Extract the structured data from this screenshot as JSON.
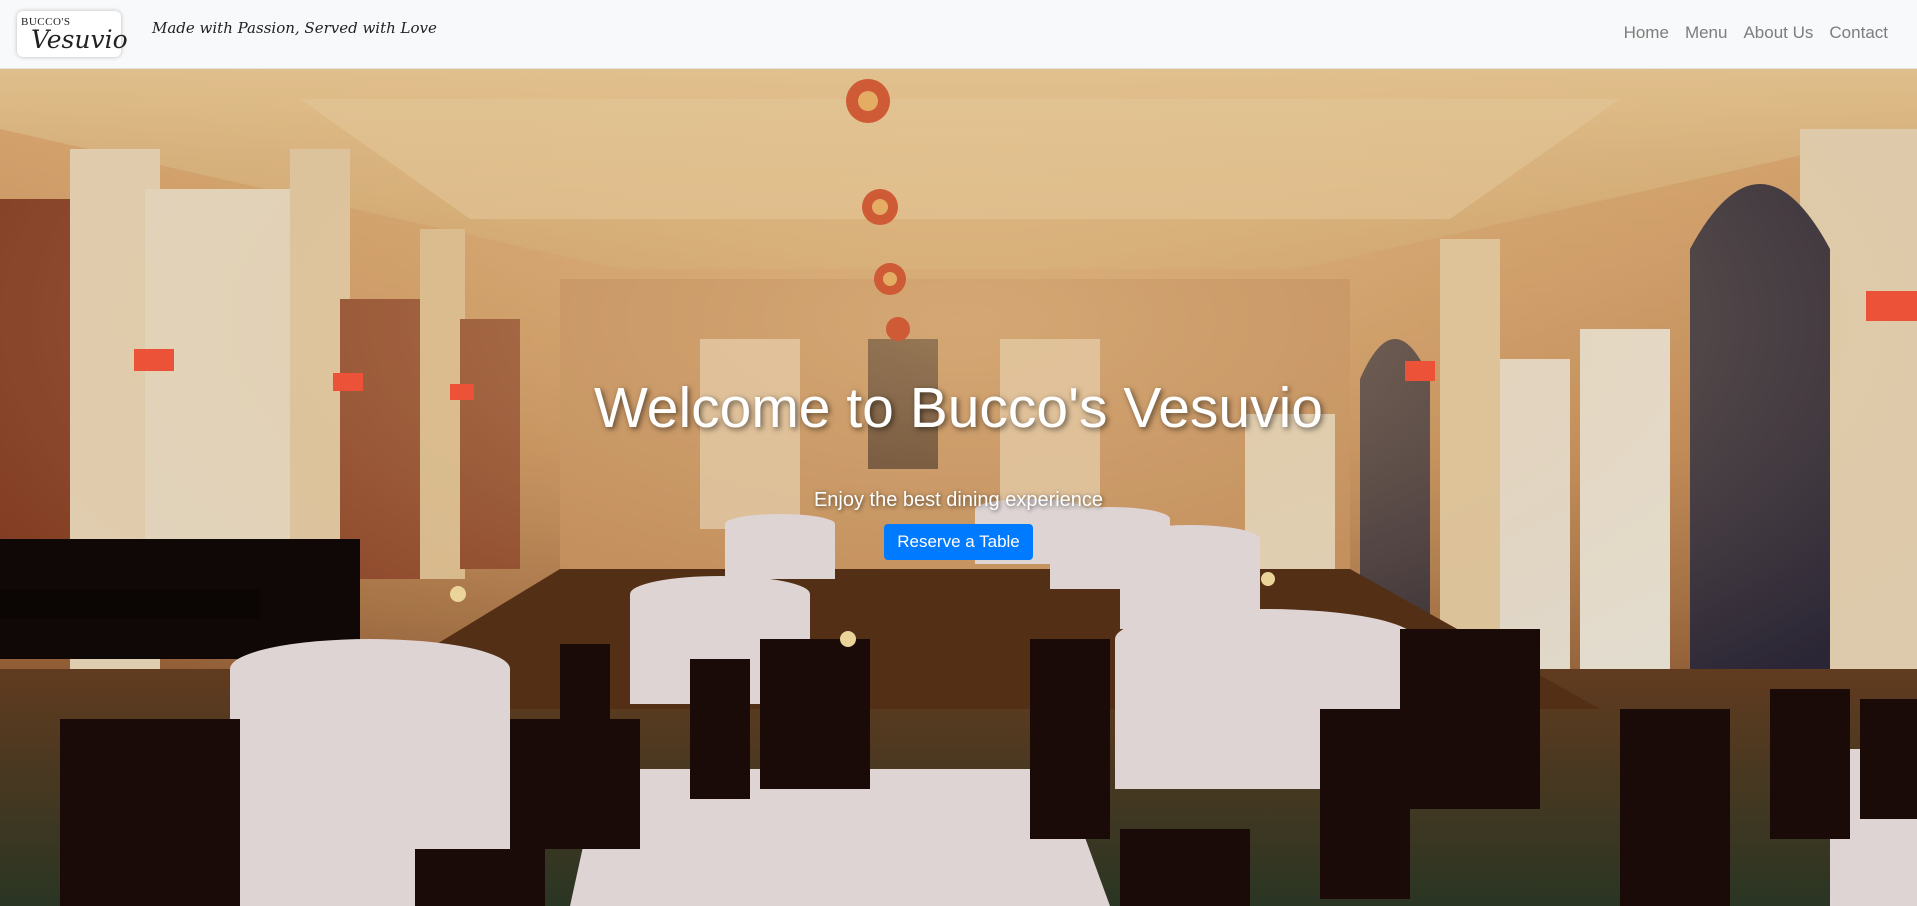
{
  "brand": {
    "logo_top": "BUCCO'S",
    "logo_bottom": "Vesuvio",
    "tagline": "Made with Passion, Served with Love"
  },
  "nav": {
    "items": [
      {
        "label": "Home"
      },
      {
        "label": "Menu"
      },
      {
        "label": "About Us"
      },
      {
        "label": "Contact"
      }
    ]
  },
  "hero": {
    "title": "Welcome to Bucco's Vesuvio",
    "subtitle": "Enjoy the best dining experience",
    "cta_label": "Reserve a Table",
    "cta_color": "#007bff"
  },
  "colors": {
    "navbar_bg": "#f8f9fa",
    "nav_link": "#7d7d7d"
  }
}
